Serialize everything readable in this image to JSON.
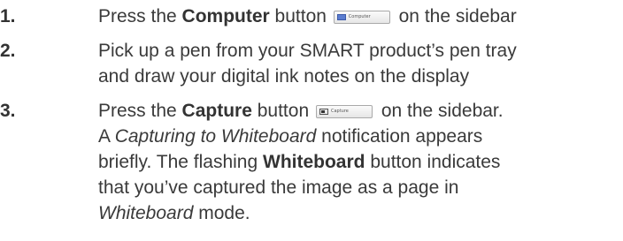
{
  "steps": [
    {
      "number": "1.",
      "lines": [
        {
          "prefix": "Press the ",
          "bold": "Computer",
          "mid": " button",
          "button_label": "Computer",
          "suffix": " on the sidebar"
        }
      ]
    },
    {
      "number": "2.",
      "lines": [
        "Pick up a pen from your SMART product’s pen tray",
        "and draw your digital ink notes on the display"
      ]
    },
    {
      "number": "3.",
      "lines": {
        "l1_prefix": "Press the ",
        "l1_bold": "Capture",
        "l1_mid": " button",
        "l1_button_label": "Capture",
        "l1_suffix": " on the sidebar.",
        "l2_prefix": "A ",
        "l2_italic": "Capturing to Whiteboard",
        "l2_suffix": " notification appears",
        "l3_prefix": "briefly. The flashing ",
        "l3_bold": "Whiteboard",
        "l3_suffix": " button indicates",
        "l4": "that you’ve captured the image as a page in",
        "l5_italic": "Whiteboard",
        "l5_suffix": " mode."
      }
    }
  ]
}
